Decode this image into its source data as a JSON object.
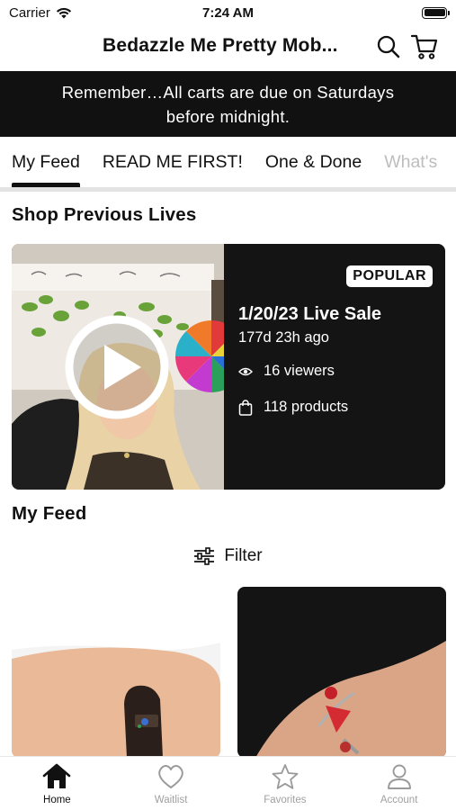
{
  "status_bar": {
    "carrier": "Carrier",
    "time": "7:24 AM"
  },
  "header": {
    "title": "Bedazzle Me Pretty Mob..."
  },
  "announcement": {
    "text": "Remember…All carts are due on Saturdays before midnight."
  },
  "tabs": [
    {
      "label": "My Feed",
      "active": true
    },
    {
      "label": "READ ME FIRST!",
      "active": false
    },
    {
      "label": "One & Done",
      "active": false
    },
    {
      "label": "What's",
      "active": false
    }
  ],
  "shop_previous": {
    "title": "Shop Previous Lives",
    "card": {
      "badge": "POPULAR",
      "title": "1/20/23 Live Sale",
      "ago": "177d 23h ago",
      "viewers": "16 viewers",
      "products": "118 products"
    }
  },
  "feed": {
    "title": "My Feed",
    "filter_label": "Filter"
  },
  "bottom_nav": [
    {
      "label": "Home",
      "icon": "home-icon",
      "active": true
    },
    {
      "label": "Waitlist",
      "icon": "heart-icon",
      "active": false
    },
    {
      "label": "Favorites",
      "icon": "star-icon",
      "active": false
    },
    {
      "label": "Account",
      "icon": "person-icon",
      "active": false
    }
  ],
  "colors": {
    "banner_bg": "#111111",
    "card_bg": "#141414",
    "inactive": "#a0a0a0"
  }
}
